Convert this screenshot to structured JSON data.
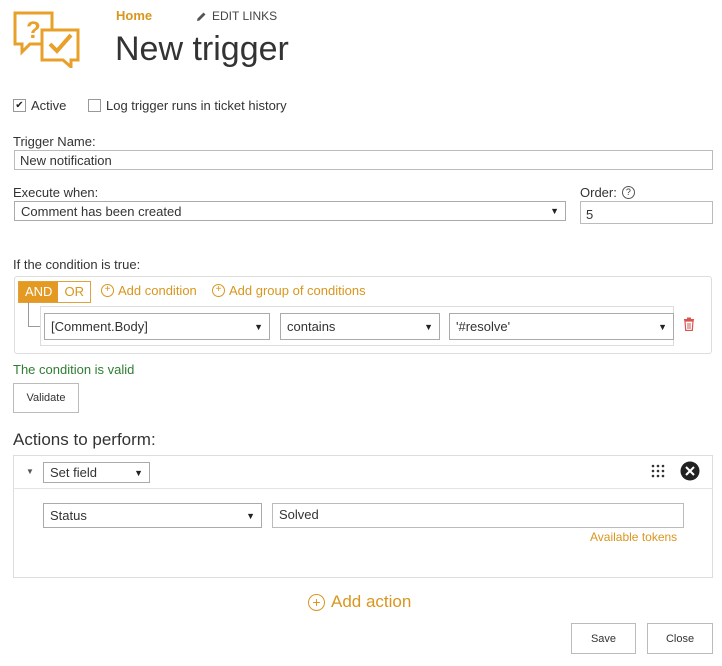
{
  "header": {
    "home": "Home",
    "edit_links": "EDIT LINKS",
    "title": "New trigger"
  },
  "options": {
    "active_label": "Active",
    "active_checked": true,
    "log_label": "Log trigger runs in ticket history",
    "log_checked": false
  },
  "trigger_name": {
    "label": "Trigger Name:",
    "value": "New notification"
  },
  "execute_when": {
    "label": "Execute when:",
    "value": "Comment has been created"
  },
  "order": {
    "label": "Order:",
    "value": "5"
  },
  "conditions": {
    "label": "If the condition is true:",
    "and": "AND",
    "or": "OR",
    "add_condition": "Add condition",
    "add_group": "Add group of conditions",
    "row": {
      "field": "[Comment.Body]",
      "operator": "contains",
      "value": "'#resolve'"
    },
    "valid_text": "The condition is valid",
    "validate_button": "Validate"
  },
  "actions": {
    "label": "Actions to perform:",
    "action_type": "Set field",
    "field": "Status",
    "value": "Solved",
    "available_tokens": "Available tokens",
    "add_action": "Add action"
  },
  "footer": {
    "save": "Save",
    "close": "Close"
  },
  "colors": {
    "accent": "#d9961e",
    "valid": "#2e7d32"
  }
}
